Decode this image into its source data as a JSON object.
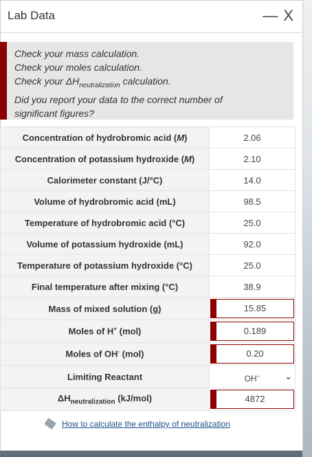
{
  "window": {
    "title": "Lab Data",
    "minimize": "—",
    "close": "X"
  },
  "feedback": {
    "line1": "Check your mass calculation.",
    "line2": "Check your moles calculation.",
    "line3_pre": "Check your ΔH",
    "line3_sub": "neutralization",
    "line3_post": " calculation.",
    "line4": "Did you report your data to the correct number of",
    "line5": "significant figures?"
  },
  "rows": [
    {
      "label": "Concentration of hydrobromic acid (",
      "unit": "M",
      "tail": ")",
      "value": "2.06"
    },
    {
      "label": "Concentration of potassium hydroxide (",
      "unit": "M",
      "tail": ")",
      "value": "2.10"
    },
    {
      "label": "Calorimeter constant (J/°C)",
      "value": "14.0"
    },
    {
      "label": "Volume of hydrobromic acid (mL)",
      "value": "98.5"
    },
    {
      "label": "Temperature of hydrobromic acid (°C)",
      "value": "25.0"
    },
    {
      "label": "Volume of potassium hydroxide (mL)",
      "value": "92.0"
    },
    {
      "label": "Temperature of potassium hydroxide (°C)",
      "value": "25.0"
    },
    {
      "label": "Final temperature after mixing (°C)",
      "value": "38.9"
    }
  ],
  "calc": {
    "mass": {
      "label": "Mass of mixed solution (g)",
      "value": "15.85"
    },
    "moles_h": {
      "label_pre": "Moles of H",
      "label_sup": "+",
      "label_post": " (mol)",
      "value": "0.189"
    },
    "moles_oh": {
      "label_pre": "Moles of OH",
      "label_sup": "-",
      "label_post": " (mol)",
      "value": "0.20"
    },
    "limiting": {
      "label": "Limiting Reactant",
      "value_pre": "OH",
      "value_sup": "−",
      "chevron": "⌄"
    },
    "dh": {
      "label_pre": "ΔH",
      "label_sub": "neutralization",
      "label_post": " (kJ/mol)",
      "value": "4872"
    }
  },
  "help": {
    "link": "How to calculate the enthalpy of neutralization",
    "icon": "tag-icon"
  },
  "colors": {
    "accent": "#8b0000",
    "link": "#1a4f8a"
  }
}
